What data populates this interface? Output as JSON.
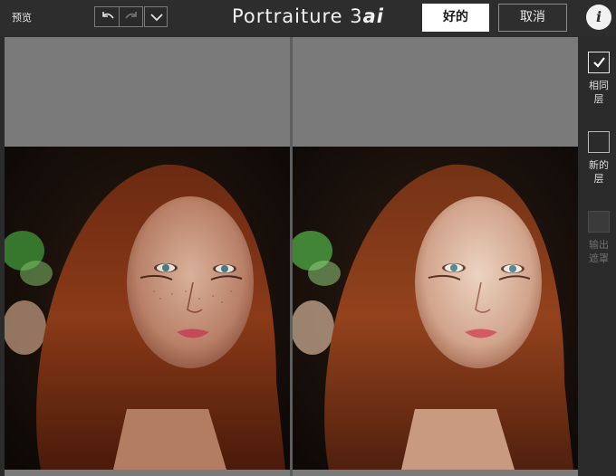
{
  "toolbar": {
    "preview_label": "预览",
    "undo_icon": "undo-icon",
    "redo_icon": "redo-icon",
    "history_dropdown_icon": "chevron-down-icon"
  },
  "app": {
    "title_main": "Portraiture 3",
    "title_version": "ai"
  },
  "buttons": {
    "ok_label": "好的",
    "cancel_label": "取消",
    "info_label": "i"
  },
  "panes": {
    "left": "before-preview",
    "right": "after-preview"
  },
  "output_options": [
    {
      "label_line1": "相同",
      "label_line2": "层",
      "checked": true,
      "enabled": true
    },
    {
      "label_line1": "新的",
      "label_line2": "层",
      "checked": false,
      "enabled": true
    },
    {
      "label_line1": "输出",
      "label_line2": "遮罩",
      "checked": false,
      "enabled": false
    }
  ],
  "colors": {
    "background": "#2b2b2b",
    "pane_gray": "#7a7a7a",
    "ok_button": "#ffffff"
  }
}
